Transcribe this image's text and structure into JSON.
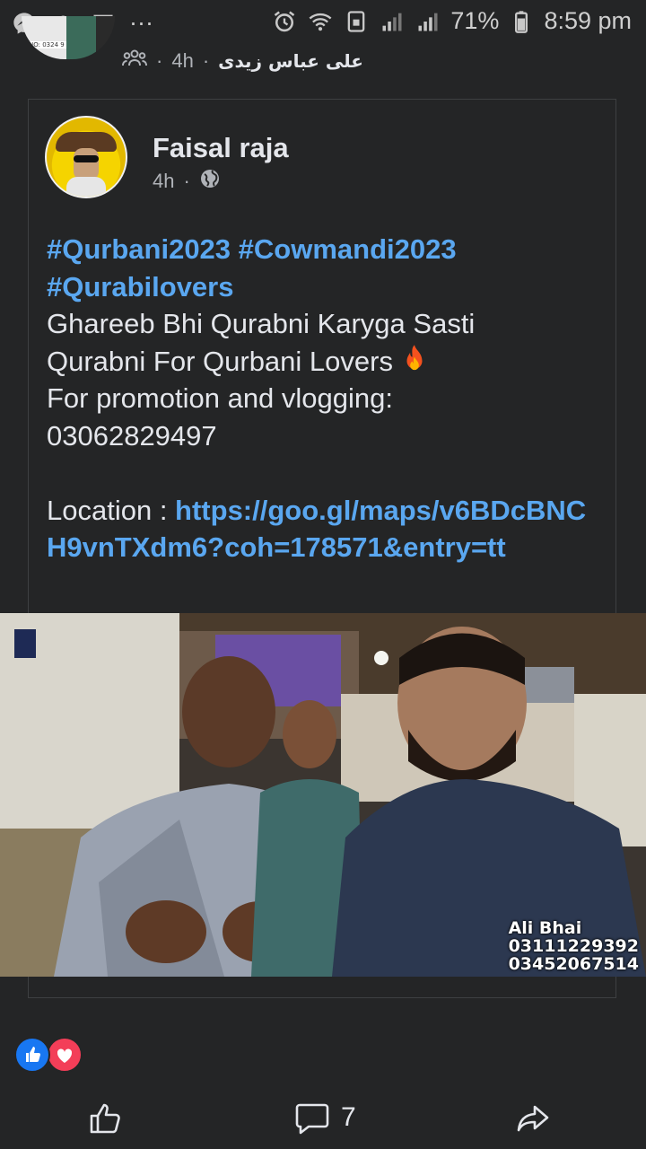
{
  "status_bar": {
    "left_icons": [
      "messenger-icon",
      "cloud-icon",
      "chat-icon",
      "more-dots-icon"
    ],
    "dots": "···",
    "battery_pct": "71%",
    "time": "8:59 pm"
  },
  "shared_by": {
    "name": "علی عباس زیدی",
    "time": "4h",
    "sep": "·",
    "audience_icon": "group-icon"
  },
  "post": {
    "author": "Faisal raja",
    "time": "4h",
    "sep": "·",
    "privacy_icon": "globe-icon",
    "hashtags_line1": "#Qurbani2023 #Cowmandi2023",
    "hashtags_line2": "#Qurabilovers",
    "line1": "Ghareeb Bhi Qurabni Karyga Sasti",
    "line2": "Qurabni For Qurbani Lovers",
    "line3": "For promotion and vlogging:",
    "phone": "03062829497",
    "location_label": "Location : ",
    "location_url": "https://goo.gl/maps/v6BDcBNCH9vnTXdm6?coh=178571&entry=tt"
  },
  "media": {
    "watermark_name": "Ali Bhai",
    "watermark_phone1": "03111229392",
    "watermark_phone2": "03452067514"
  },
  "reactions": [
    "like",
    "love"
  ],
  "actions": {
    "comment_count": "7"
  },
  "colors": {
    "background": "#242526",
    "link": "#5aa7f0",
    "like": "#1877f2",
    "love": "#f33e58"
  }
}
